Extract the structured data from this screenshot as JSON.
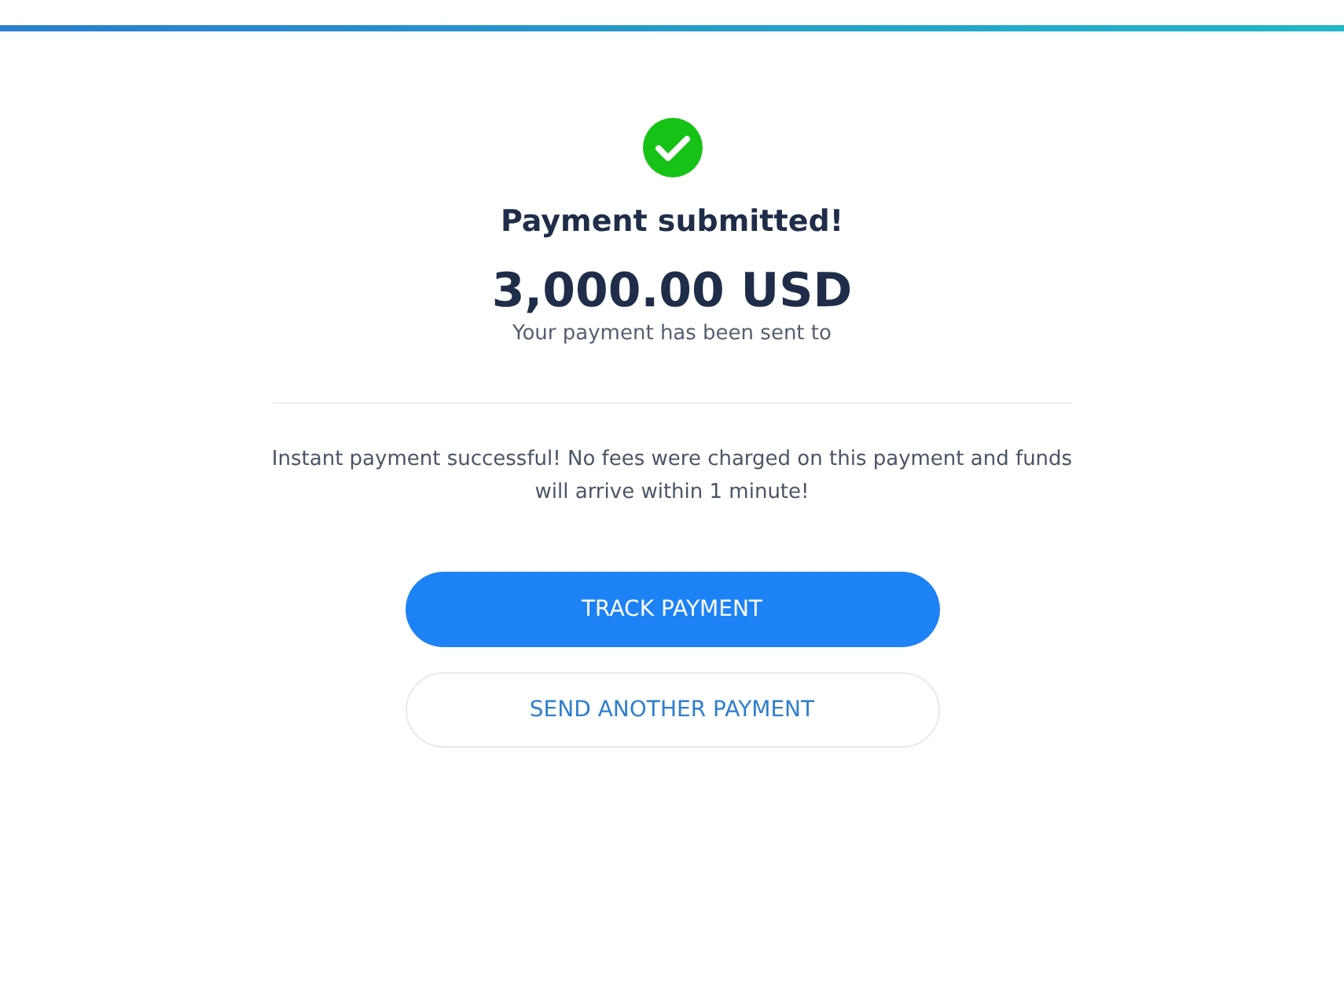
{
  "status": {
    "title": "Payment submitted!",
    "amount": "3,000.00 USD",
    "recipient_note": "Your payment has been sent to"
  },
  "notice": "Instant payment successful! No fees were charged on this payment and funds will arrive within 1 minute!",
  "buttons": [
    {
      "label": "TRACK PAYMENT",
      "kind": "primary"
    },
    {
      "label": "SEND ANOTHER PAYMENT",
      "kind": "secondary"
    }
  ]
}
